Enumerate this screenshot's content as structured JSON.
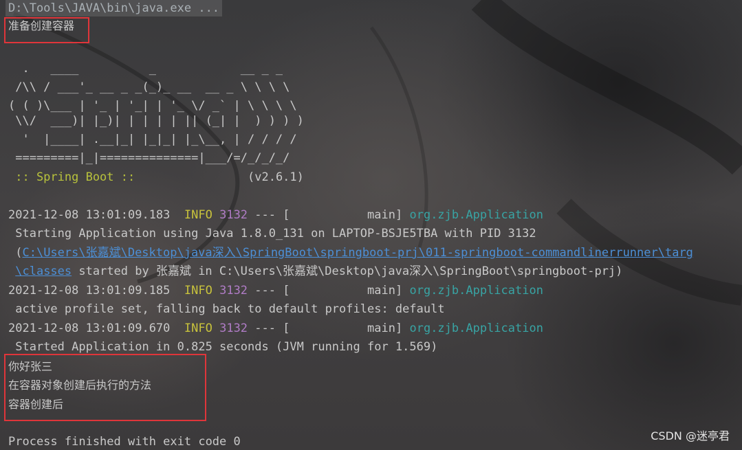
{
  "console": {
    "command": "D:\\Tools\\JAVA\\bin\\java.exe ...",
    "before_msg": "准备创建容器",
    "banner": [
      "  .   ____          _            __ _ _",
      " /\\\\ / ___'_ __ _ _(_)_ __  __ _ \\ \\ \\ \\",
      "( ( )\\___ | '_ | '_| | '_ \\/ _` | \\ \\ \\ \\",
      " \\\\/  ___)| |_)| | | | | || (_| |  ) ) ) )",
      "  '  |____| .__|_| |_|_| |_\\__, | / / / /",
      " =========|_|==============|___/=/_/_/_/"
    ],
    "spring_label": " :: Spring Boot ::",
    "spring_version": "(v2.6.1)",
    "logs": [
      {
        "timestamp": "2021-12-08 13:01:09.183",
        "level": "INFO",
        "pid": "3132",
        "sep": "--- [           main]",
        "logger": "org.zjb.Application",
        "message": " Starting Application using Java 1.8.0_131 on LAPTOP-BSJE5TBA with PID 3132"
      },
      {
        "timestamp": "2021-12-08 13:01:09.185",
        "level": "INFO",
        "pid": "3132",
        "sep": "--- [           main]",
        "logger": "org.zjb.Application",
        "message": " active profile set, falling back to default profiles: default"
      },
      {
        "timestamp": "2021-12-08 13:01:09.670",
        "level": "INFO",
        "pid": "3132",
        "sep": "--- [           main]",
        "logger": "org.zjb.Application",
        "message": " Started Application in 0.825 seconds (JVM running for 1.569)"
      }
    ],
    "path_open": " (",
    "path_link_1": "C:\\Users\\张嘉斌\\Desktop\\java深入\\SpringBoot\\springboot-prj\\011-springboot-commandlinerrunner\\targ",
    "path_link_2": "\\classes",
    "path_rest": " started by 张嘉斌 in C:\\Users\\张嘉斌\\Desktop\\java深入\\SpringBoot\\springboot-prj)",
    "path_indent": " ",
    "after_msgs": [
      "你好张三",
      "在容器对象创建后执行的方法",
      "容器创建后"
    ],
    "exit_msg": "Process finished with exit code 0"
  },
  "watermark": "CSDN @迷亭君",
  "colors": {
    "highlight_box": "#e0353a",
    "info": "#c8c23c",
    "pid": "#b07cc6",
    "logger": "#38a4a4",
    "link": "#4c8fd6",
    "spring": "#b8c23c"
  }
}
